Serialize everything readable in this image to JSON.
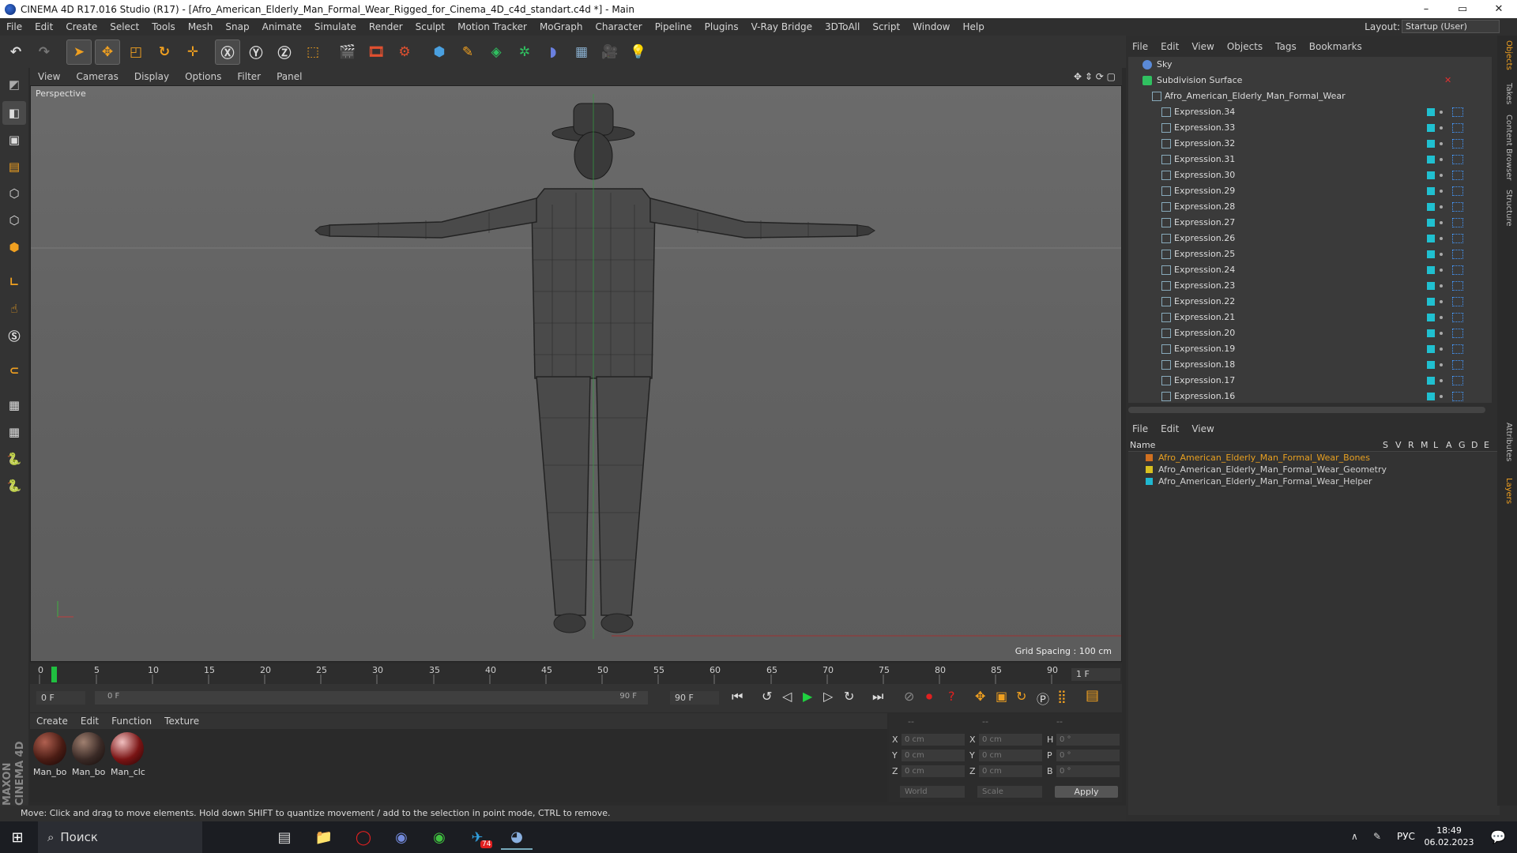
{
  "window": {
    "title": "CINEMA 4D R17.016 Studio (R17) - [Afro_American_Elderly_Man_Formal_Wear_Rigged_for_Cinema_4D_c4d_standart.c4d *] - Main",
    "controls": {
      "minimize": "–",
      "maximize": "▭",
      "close": "✕"
    }
  },
  "menubar": {
    "items": [
      "File",
      "Edit",
      "Create",
      "Select",
      "Tools",
      "Mesh",
      "Snap",
      "Animate",
      "Simulate",
      "Render",
      "Sculpt",
      "Motion Tracker",
      "MoGraph",
      "Character",
      "Pipeline",
      "Plugins",
      "V-Ray Bridge",
      "3DToAll",
      "Script",
      "Window",
      "Help"
    ],
    "layout_label": "Layout:",
    "layout_value": "Startup (User)"
  },
  "viewport": {
    "menu": [
      "View",
      "Cameras",
      "Display",
      "Options",
      "Filter",
      "Panel"
    ],
    "label": "Perspective",
    "grid_spacing": "Grid Spacing : 100 cm"
  },
  "timeline": {
    "ticks": [
      "0",
      "5",
      "10",
      "15",
      "20",
      "25",
      "30",
      "35",
      "40",
      "45",
      "50",
      "55",
      "60",
      "65",
      "70",
      "75",
      "80",
      "85",
      "90"
    ],
    "current_frame": "1 F",
    "start_field": "0 F",
    "range_start": "0 F",
    "range_end": "90 F",
    "end_field": "90 F"
  },
  "materials": {
    "menu": [
      "Create",
      "Edit",
      "Function",
      "Texture"
    ],
    "items": [
      {
        "label": "Man_bo",
        "color": "#4a1c14"
      },
      {
        "label": "Man_bo",
        "color": "#3a2a26"
      },
      {
        "label": "Man_clc",
        "color": "#7a1414"
      }
    ]
  },
  "coordinates": {
    "header": [
      "--",
      "--",
      "--"
    ],
    "rows": [
      {
        "a": "X",
        "av": "0 cm",
        "b": "X",
        "bv": "0 cm",
        "c": "H",
        "cv": "0 °"
      },
      {
        "a": "Y",
        "av": "0 cm",
        "b": "Y",
        "bv": "0 cm",
        "c": "P",
        "cv": "0 °"
      },
      {
        "a": "Z",
        "av": "0 cm",
        "b": "Z",
        "bv": "0 cm",
        "c": "B",
        "cv": "0 °"
      }
    ],
    "world": "World",
    "scale": "Scale",
    "apply": "Apply"
  },
  "status": "Move: Click and drag to move elements. Hold down SHIFT to quantize movement / add to the selection in point mode, CTRL to remove.",
  "object_manager": {
    "menu": [
      "File",
      "Edit",
      "View",
      "Objects",
      "Tags",
      "Bookmarks"
    ],
    "objects": [
      {
        "name": "Sky",
        "indent": 0
      },
      {
        "name": "Subdivision Surface",
        "indent": 0
      },
      {
        "name": "Afro_American_Elderly_Man_Formal_Wear",
        "indent": 1
      },
      {
        "name": "Expression.34",
        "indent": 2
      },
      {
        "name": "Expression.33",
        "indent": 2
      },
      {
        "name": "Expression.32",
        "indent": 2
      },
      {
        "name": "Expression.31",
        "indent": 2
      },
      {
        "name": "Expression.30",
        "indent": 2
      },
      {
        "name": "Expression.29",
        "indent": 2
      },
      {
        "name": "Expression.28",
        "indent": 2
      },
      {
        "name": "Expression.27",
        "indent": 2
      },
      {
        "name": "Expression.26",
        "indent": 2
      },
      {
        "name": "Expression.25",
        "indent": 2
      },
      {
        "name": "Expression.24",
        "indent": 2
      },
      {
        "name": "Expression.23",
        "indent": 2
      },
      {
        "name": "Expression.22",
        "indent": 2
      },
      {
        "name": "Expression.21",
        "indent": 2
      },
      {
        "name": "Expression.20",
        "indent": 2
      },
      {
        "name": "Expression.19",
        "indent": 2
      },
      {
        "name": "Expression.18",
        "indent": 2
      },
      {
        "name": "Expression.17",
        "indent": 2
      },
      {
        "name": "Expression.16",
        "indent": 2
      }
    ]
  },
  "layer_manager": {
    "menu": [
      "File",
      "Edit",
      "View"
    ],
    "columns": [
      "Name",
      "S",
      "V",
      "R",
      "M",
      "L",
      "A",
      "G",
      "D",
      "E"
    ],
    "layers": [
      {
        "name": "Afro_American_Elderly_Man_Formal_Wear_Bones",
        "color": "#d07020",
        "text_color": "#e8a020"
      },
      {
        "name": "Afro_American_Elderly_Man_Formal_Wear_Geometry",
        "color": "#d8c020",
        "text_color": "#d0d0d0"
      },
      {
        "name": "Afro_American_Elderly_Man_Formal_Wear_Helper",
        "color": "#20b8d0",
        "text_color": "#d0d0d0"
      }
    ]
  },
  "right_tabs": [
    "Objects",
    "Takes",
    "Content Browser",
    "Structure",
    "Attributes",
    "Layers"
  ],
  "taskbar": {
    "search": "Поиск",
    "lang": "РУС",
    "time": "18:49",
    "date": "06.02.2023",
    "telegram_badge": "74"
  },
  "side_brand": "MAXON CINEMA 4D"
}
